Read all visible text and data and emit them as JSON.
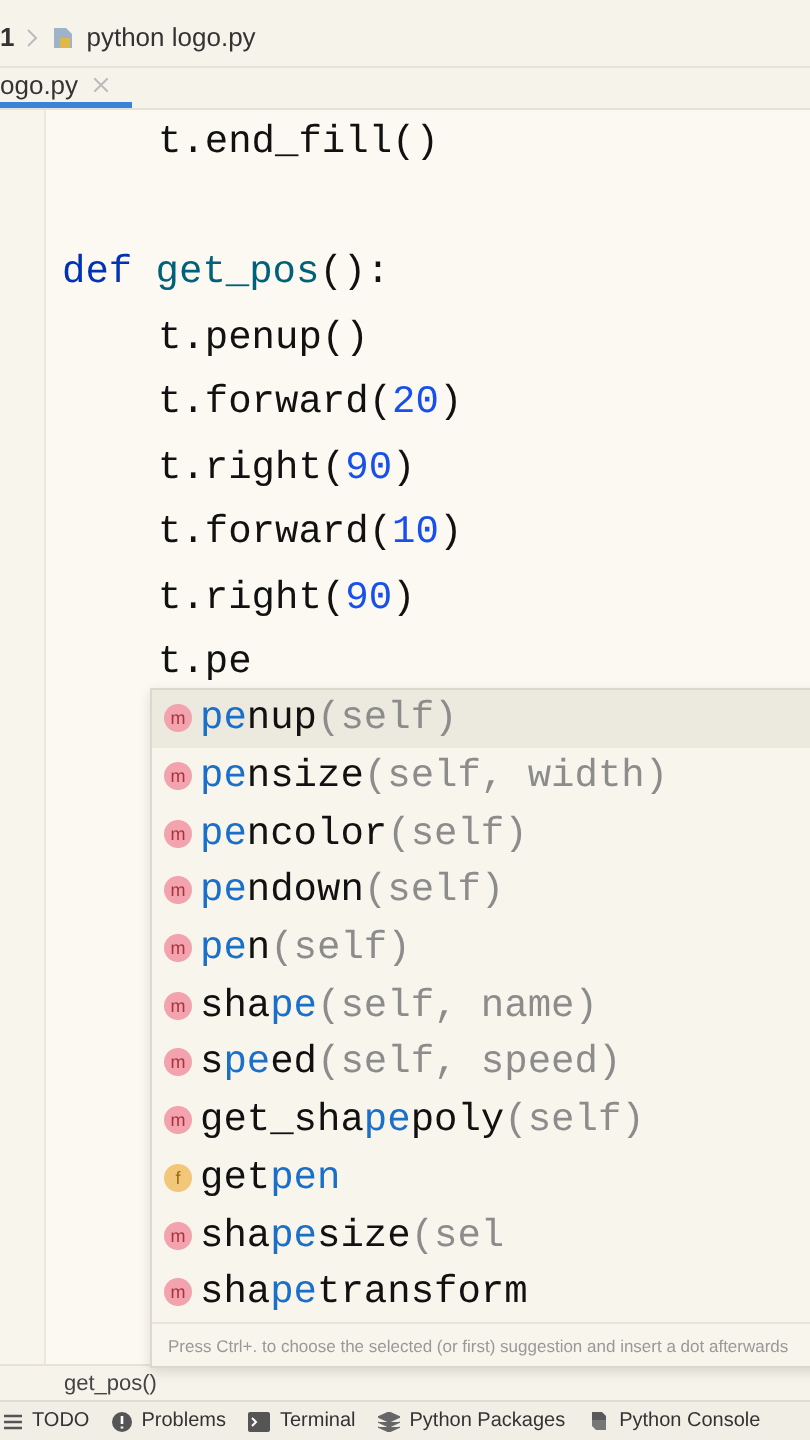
{
  "navbar": {
    "project": "1",
    "file": "python logo.py"
  },
  "tabs": [
    {
      "label": "ogo.py",
      "selected": true
    }
  ],
  "editor": {
    "lines": [
      {
        "kind": "body",
        "tokens": [
          {
            "kind": "plain",
            "text": "t.end_fill()"
          }
        ]
      },
      {
        "kind": "blank"
      },
      {
        "kind": "header",
        "tokens": [
          {
            "kind": "keyword",
            "text": "def"
          },
          {
            "kind": "function",
            "text": "get_pos"
          },
          {
            "kind": "plain",
            "text": "():"
          }
        ]
      },
      {
        "kind": "body",
        "tokens": [
          {
            "kind": "plain",
            "text": "t.penup()"
          }
        ]
      },
      {
        "kind": "body",
        "tokens": [
          {
            "kind": "plain",
            "text": "t.forward("
          },
          {
            "kind": "number",
            "text": "20"
          },
          {
            "kind": "plain",
            "text": ")"
          }
        ]
      },
      {
        "kind": "body",
        "tokens": [
          {
            "kind": "plain",
            "text": "t.right("
          },
          {
            "kind": "number",
            "text": "90"
          },
          {
            "kind": "plain",
            "text": ")"
          }
        ]
      },
      {
        "kind": "body",
        "tokens": [
          {
            "kind": "plain",
            "text": "t.forward("
          },
          {
            "kind": "number",
            "text": "10"
          },
          {
            "kind": "plain",
            "text": ")"
          }
        ]
      },
      {
        "kind": "body",
        "tokens": [
          {
            "kind": "plain",
            "text": "t.right("
          },
          {
            "kind": "number",
            "text": "90"
          },
          {
            "kind": "plain",
            "text": ")"
          }
        ]
      },
      {
        "kind": "body",
        "tokens": [
          {
            "kind": "plain",
            "text": "t.pe"
          }
        ]
      }
    ]
  },
  "completion": {
    "items": [
      {
        "kind": "method",
        "badge": "m",
        "selected": true,
        "parts": [
          {
            "text": "pe",
            "matched": true
          },
          {
            "text": "nup",
            "matched": false
          }
        ],
        "params": "(self)"
      },
      {
        "kind": "method",
        "badge": "m",
        "selected": false,
        "parts": [
          {
            "text": "pe",
            "matched": true
          },
          {
            "text": "nsize",
            "matched": false
          }
        ],
        "params": "(self, width)"
      },
      {
        "kind": "method",
        "badge": "m",
        "selected": false,
        "parts": [
          {
            "text": "pe",
            "matched": true
          },
          {
            "text": "ncolor",
            "matched": false
          }
        ],
        "params": "(self)"
      },
      {
        "kind": "method",
        "badge": "m",
        "selected": false,
        "parts": [
          {
            "text": "pe",
            "matched": true
          },
          {
            "text": "ndown",
            "matched": false
          }
        ],
        "params": "(self)"
      },
      {
        "kind": "method",
        "badge": "m",
        "selected": false,
        "parts": [
          {
            "text": "pe",
            "matched": true
          },
          {
            "text": "n",
            "matched": false
          }
        ],
        "params": "(self)"
      },
      {
        "kind": "method",
        "badge": "m",
        "selected": false,
        "parts": [
          {
            "text": "sha",
            "matched": false
          },
          {
            "text": "pe",
            "matched": true
          }
        ],
        "params": "(self, name)"
      },
      {
        "kind": "method",
        "badge": "m",
        "selected": false,
        "parts": [
          {
            "text": "s",
            "matched": false
          },
          {
            "text": "pe",
            "matched": true
          },
          {
            "text": "ed",
            "matched": false
          }
        ],
        "params": "(self, speed)"
      },
      {
        "kind": "method",
        "badge": "m",
        "selected": false,
        "parts": [
          {
            "text": "get_sha",
            "matched": false
          },
          {
            "text": "pe",
            "matched": true
          },
          {
            "text": "poly",
            "matched": false
          }
        ],
        "params": "(self)"
      },
      {
        "kind": "function",
        "badge": "f",
        "selected": false,
        "parts": [
          {
            "text": "get",
            "matched": false
          },
          {
            "text": "pen",
            "matched": true
          }
        ]
      },
      {
        "kind": "method",
        "badge": "m",
        "selected": false,
        "parts": [
          {
            "text": "sha",
            "matched": false
          },
          {
            "text": "pe",
            "matched": true
          },
          {
            "text": "size",
            "matched": false
          }
        ],
        "params": "(sel"
      },
      {
        "kind": "method",
        "badge": "m",
        "selected": false,
        "parts": [
          {
            "text": "sha",
            "matched": false
          },
          {
            "text": "pe",
            "matched": true
          },
          {
            "text": "transform",
            "matched": false
          }
        ]
      }
    ],
    "hint": "Press Ctrl+. to choose the selected (or first) suggestion and insert a dot afterwards"
  },
  "breadcrumb": "get_pos()",
  "tool_windows": [
    {
      "kind": "todo",
      "label": "TODO"
    },
    {
      "kind": "problems",
      "label": "Problems"
    },
    {
      "kind": "terminal",
      "label": "Terminal"
    },
    {
      "kind": "packages",
      "label": "Python Packages"
    },
    {
      "kind": "console",
      "label": "Python Console"
    }
  ]
}
